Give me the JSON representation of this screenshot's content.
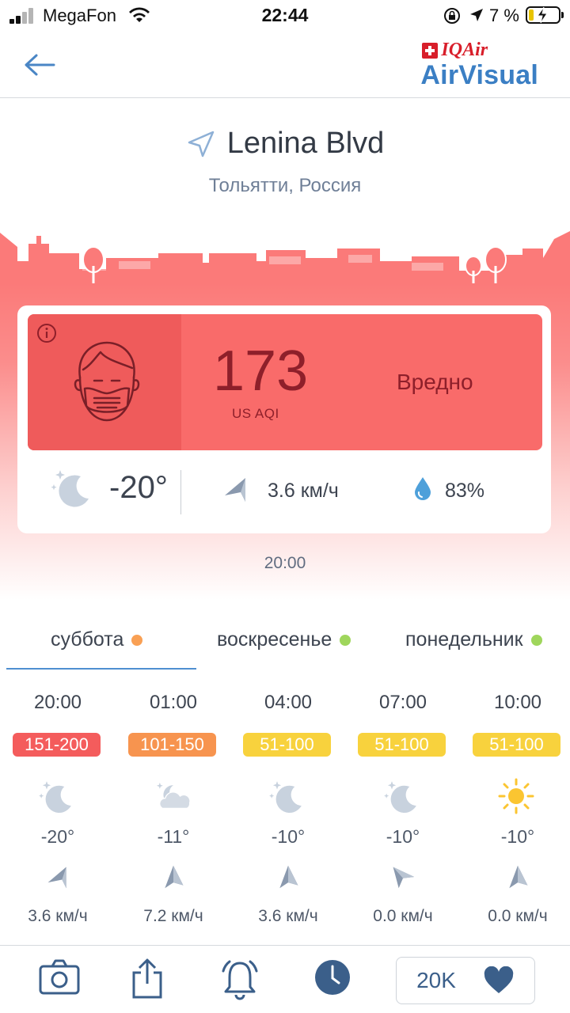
{
  "status_bar": {
    "carrier": "MegaFon",
    "time": "22:44",
    "battery_percent": "7 %",
    "battery_level": 0.07
  },
  "header": {
    "logo_brand": "IQAir",
    "logo_product": "AirVisual"
  },
  "location": {
    "name": "Lenina Blvd",
    "subtitle": "Тольятти, Россия"
  },
  "aqi": {
    "value": "173",
    "unit": "US AQI",
    "status": "Вредно",
    "color": "#f96b6a"
  },
  "weather": {
    "temperature": "-20°",
    "wind": "3.6 км/ч",
    "humidity": "83%"
  },
  "update_time": "20:00",
  "tabs": [
    {
      "label": "суббота",
      "dot_color": "#f9a054",
      "active": true
    },
    {
      "label": "воскресенье",
      "dot_color": "#9fd65c",
      "active": false
    },
    {
      "label": "понедельник",
      "dot_color": "#9fd65c",
      "active": false
    }
  ],
  "forecast": [
    {
      "time": "20:00",
      "aqi_range": "151-200",
      "badge_color": "#f45c5c",
      "icon": "moon-stars-icon",
      "temp": "-20°",
      "wind": "3.6 км/ч"
    },
    {
      "time": "01:00",
      "aqi_range": "101-150",
      "badge_color": "#f7944f",
      "icon": "cloudy-night-icon",
      "temp": "-11°",
      "wind": "7.2 км/ч"
    },
    {
      "time": "04:00",
      "aqi_range": "51-100",
      "badge_color": "#f8d23d",
      "icon": "moon-stars-icon",
      "temp": "-10°",
      "wind": "3.6 км/ч"
    },
    {
      "time": "07:00",
      "aqi_range": "51-100",
      "badge_color": "#f8d23d",
      "icon": "moon-stars-icon",
      "temp": "-10°",
      "wind": "0.0 км/ч"
    },
    {
      "time": "10:00",
      "aqi_range": "51-100",
      "badge_color": "#f8d23d",
      "icon": "sun-icon",
      "temp": "-10°",
      "wind": "0.0 км/ч"
    }
  ],
  "toolbar": {
    "like_count": "20K"
  },
  "colors": {
    "accent": "#3b7fc4",
    "icon_blue": "#3b5f8a"
  }
}
